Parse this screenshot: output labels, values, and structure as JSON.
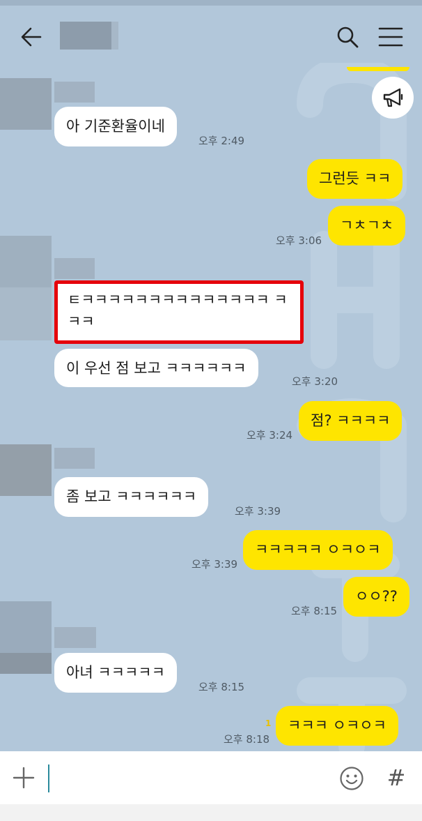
{
  "header": {
    "back_icon": "arrow-left-icon",
    "search_icon": "search-icon",
    "menu_icon": "hamburger-menu-icon",
    "notice_icon": "megaphone-icon"
  },
  "colors": {
    "background": "#b2c7da",
    "outgoing_bubble": "#fee500",
    "incoming_bubble": "#ffffff",
    "highlight_border": "#e5000b"
  },
  "messages": [
    {
      "side": "in",
      "text": "아 기준환율이네",
      "time": "오후 2:49"
    },
    {
      "side": "out",
      "text": "그런듯 ㅋㅋ"
    },
    {
      "side": "out",
      "text": "ㄱㅊㄱㅊ",
      "time": "오후 3:06"
    },
    {
      "side": "in",
      "text": "ㅌㅋㅋㅋㅋㅋㅋㅋㅋㅋㅋㅋㅋㅋㅋ ㅋㅋㅋ",
      "highlighted": true
    },
    {
      "side": "in",
      "text": "이 우선 점 보고 ㅋㅋㅋㅋㅋㅋ",
      "time": "오후 3:20"
    },
    {
      "side": "out",
      "text": "점? ㅋㅋㅋㅋ",
      "time": "오후 3:24"
    },
    {
      "side": "in",
      "text": "좀 보고 ㅋㅋㅋㅋㅋㅋ",
      "time": "오후 3:39"
    },
    {
      "side": "out",
      "text": "ㅋㅋㅋㅋㅋ ㅇㅋㅇㅋ",
      "time": "오후 3:39"
    },
    {
      "side": "out",
      "text": "ㅇㅇ??",
      "time": "오후 8:15"
    },
    {
      "side": "in",
      "text": "아녀 ㅋㅋㅋㅋㅋ",
      "time": "오후 8:15"
    },
    {
      "side": "out",
      "text": "ㅋㅋㅋ ㅇㅋㅇㅋ",
      "time": "오후 8:18",
      "unread": "1"
    }
  ],
  "input": {
    "value": "",
    "plus_icon": "plus-icon",
    "emoji_icon": "emoji-icon",
    "hashtag_label": "#"
  }
}
